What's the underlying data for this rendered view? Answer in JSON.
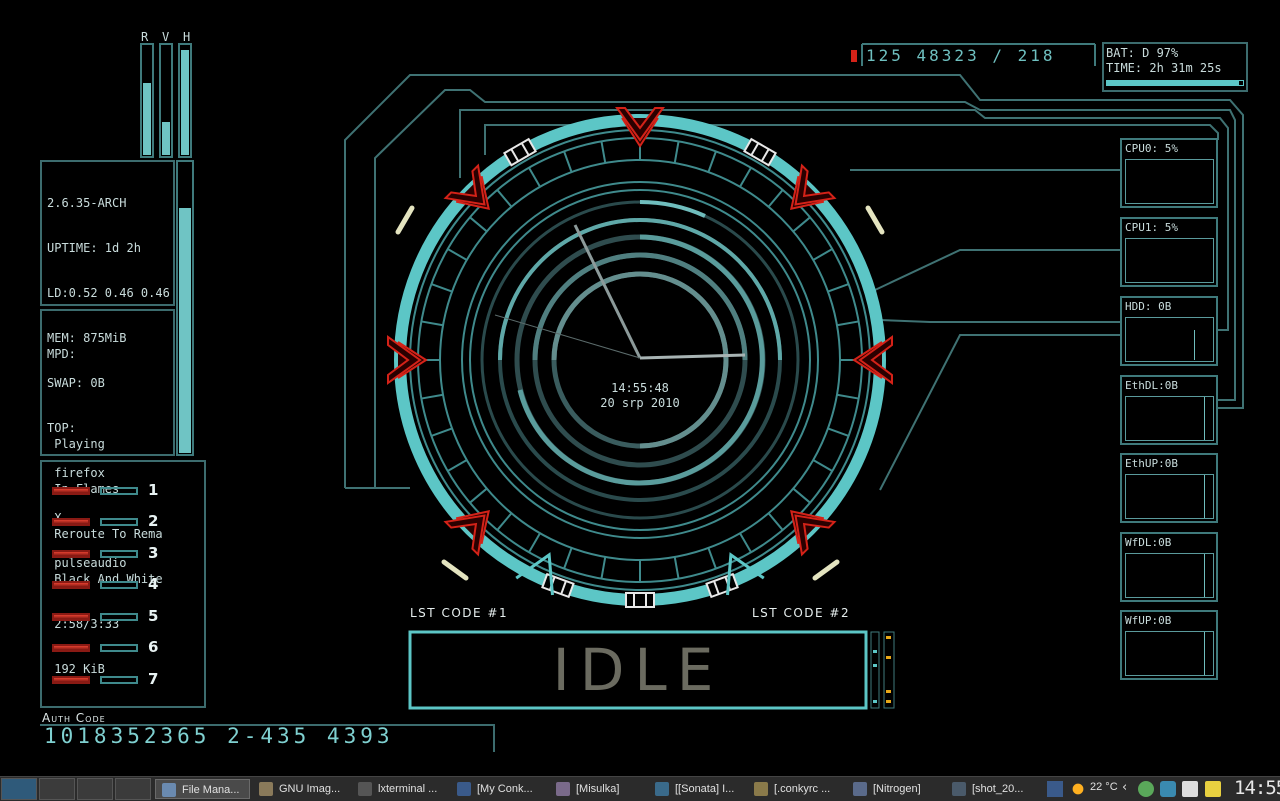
{
  "colors": {
    "accent": "#5fc8c8",
    "line": "#3c6c6e",
    "red": "#c8201a",
    "bg": "#000000"
  },
  "bars": {
    "labels": [
      "R",
      "V",
      "H"
    ],
    "levels": [
      0.65,
      0.3,
      0.95
    ]
  },
  "sysinfo": {
    "kernel": "2.6.35-ARCH",
    "uptime": "UPTIME: 1d 2h",
    "load": "LD:0.52 0.46 0.46",
    "mem": "MEM: 875MiB",
    "swap": "SWAP: 0B",
    "top_label": "TOP:",
    "top": [
      " firefox",
      " X",
      " pulseaudio"
    ]
  },
  "mpd": {
    "label": "MPD:",
    "lines": [
      " Playing",
      " In Flames",
      " Reroute To Rema",
      " Black And White",
      " 2:58/3:33",
      " 192 KiB"
    ]
  },
  "workspaces": [
    "1",
    "2",
    "3",
    "4",
    "5",
    "6",
    "7"
  ],
  "auth": {
    "label": "Auth Code",
    "code": "1018352365 2-435 4393"
  },
  "topcode": {
    "digits": "125 48323 / 218"
  },
  "battery": {
    "bat": "BAT: D 97%",
    "time": "TIME: 2h 31m 25s",
    "level": 0.97
  },
  "clock": {
    "time": "14:55:48",
    "date": "20 srp 2010"
  },
  "lst": {
    "left": "LST CODE #1",
    "right": "LST CODE #2",
    "status": "IDLE"
  },
  "graphs": [
    {
      "label": "CPU0: 5%",
      "icon": "cpu-graph"
    },
    {
      "label": "CPU1: 5%",
      "icon": "cpu-graph"
    },
    {
      "label": "HDD: 0B",
      "icon": "disk-graph"
    },
    {
      "label": "EthDL:0B",
      "icon": "net-graph"
    },
    {
      "label": "EthUP:0B",
      "icon": "net-graph"
    },
    {
      "label": "WfDL:0B",
      "icon": "wifi-graph"
    },
    {
      "label": "WfUP:0B",
      "icon": "wifi-graph"
    }
  ],
  "taskbar": {
    "tasks": [
      {
        "label": "File Mana...",
        "icon": "file-manager-icon",
        "color": "#6a8ab0"
      },
      {
        "label": "GNU Imag...",
        "icon": "gimp-icon",
        "color": "#8a7a5a"
      },
      {
        "label": "lxterminal ...",
        "icon": "terminal-icon",
        "color": "#555"
      },
      {
        "label": "[My Conk...",
        "icon": "browser-icon",
        "color": "#3a5a8a"
      },
      {
        "label": "[Misulka]",
        "icon": "image-viewer-icon",
        "color": "#7a6a8a"
      },
      {
        "label": "[[Sonata] I...",
        "icon": "music-icon",
        "color": "#3a6a8a"
      },
      {
        "label": "[.conkyrc ...",
        "icon": "text-editor-icon",
        "color": "#8a7a4a"
      },
      {
        "label": "[Nitrogen]",
        "icon": "nitrogen-icon",
        "color": "#5a6a8a"
      },
      {
        "label": "[shot_20...",
        "icon": "screenshot-icon",
        "color": "#4a5a6a"
      }
    ],
    "weather": "22 °C",
    "clock": "14:55"
  }
}
